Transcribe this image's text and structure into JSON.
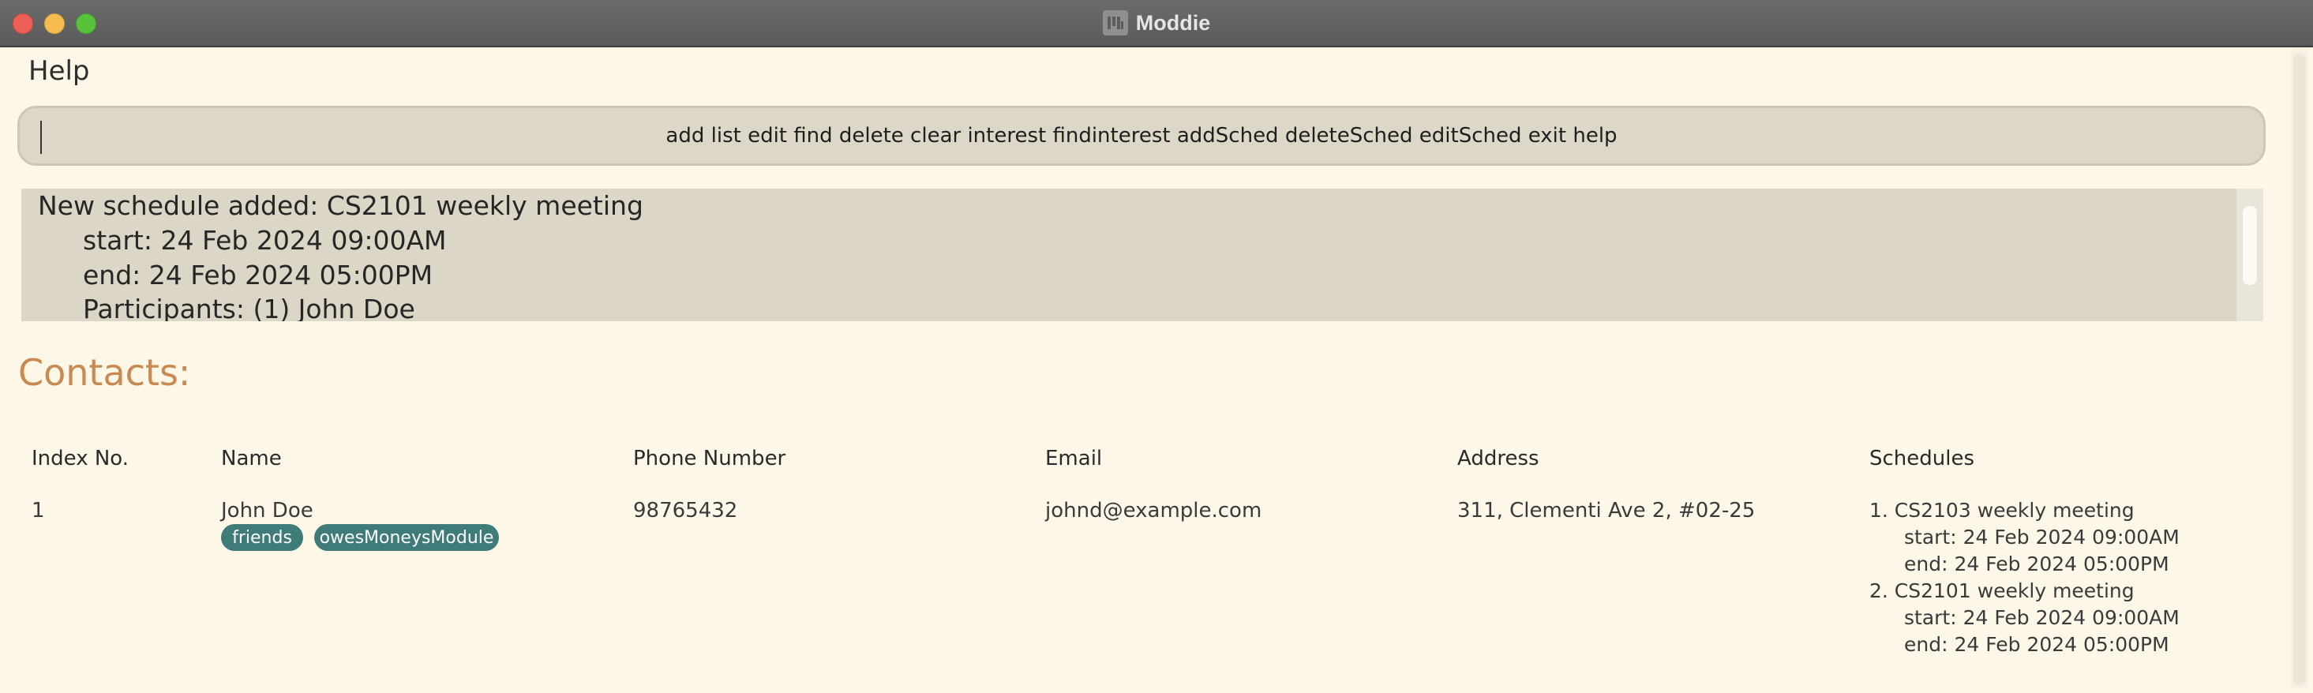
{
  "window": {
    "title": "Moddie",
    "icon": "moddie-app-icon"
  },
  "menu": {
    "help_label": "Help"
  },
  "command": {
    "placeholder": "add list edit find delete clear interest findinterest addSched deleteSched editSched exit help",
    "value": ""
  },
  "result": {
    "line1": "New schedule added: CS2101 weekly meeting",
    "line2": "start: 24 Feb 2024 09:00AM",
    "line3": "end: 24 Feb 2024 05:00PM",
    "line4": "Participants: (1) John Doe"
  },
  "contacts": {
    "heading": "Contacts:",
    "columns": [
      "Index No.",
      "Name",
      "Phone Number",
      "Email",
      "Address",
      "Schedules"
    ],
    "rows": [
      {
        "index": "1",
        "name": "John Doe",
        "tags": [
          "friends",
          "owesMoneysModule"
        ],
        "phone": "98765432",
        "email": "johnd@example.com",
        "address": "311, Clementi Ave 2, #02-25",
        "schedules": [
          {
            "title": "1. CS2103 weekly meeting",
            "start": "start: 24 Feb 2024 09:00AM",
            "end": "end: 24 Feb 2024 05:00PM"
          },
          {
            "title": "2. CS2101 weekly meeting",
            "start": "start: 24 Feb 2024 09:00AM",
            "end": "end: 24 Feb 2024 05:00PM"
          }
        ]
      }
    ]
  },
  "colors": {
    "background": "#fdf7e8",
    "heading_accent": "#c88a52",
    "tag": "#3f7b78",
    "panel": "#dbd6c6"
  }
}
